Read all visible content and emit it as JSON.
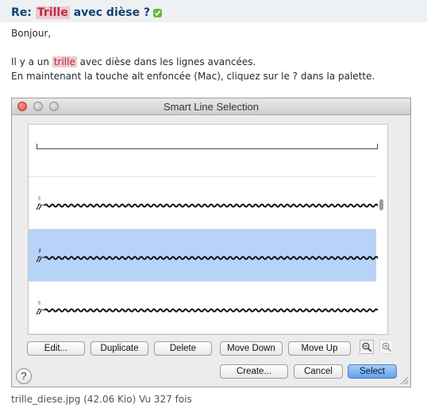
{
  "post": {
    "title_prefix": "Re:",
    "title_highlight": "Trille",
    "title_suffix": "avec dièse ?",
    "greeting": "Bonjour,",
    "line1_before": "Il y a un",
    "line1_highlight": "trille",
    "line1_after": "avec dièse dans les lignes avancées.",
    "line2": "En maintenant la touche alt enfoncée (Mac), cliquez sur le ? dans la palette."
  },
  "dialog": {
    "title": "Smart Line Selection",
    "rows": [
      {
        "kind": "bracket-line",
        "selected": false
      },
      {
        "kind": "trill-natural",
        "selected": false
      },
      {
        "kind": "trill-sharp",
        "selected": true
      },
      {
        "kind": "trill-natural",
        "selected": false
      }
    ],
    "buttons": {
      "edit": "Edit...",
      "duplicate": "Duplicate",
      "delete": "Delete",
      "move_down": "Move Down",
      "move_up": "Move Up",
      "create": "Create...",
      "cancel": "Cancel",
      "select": "Select"
    },
    "help": "?",
    "icons": [
      "zoom-out-icon",
      "zoom-in-icon",
      "help-icon",
      "resize-grip-icon"
    ]
  },
  "caption": "trille_diese.jpg (42.06 Kio) Vu 327 fois",
  "colors": {
    "title": "#16436e",
    "highlight_bg": "#f0c7cf",
    "selected_row": "#b7d3f7",
    "primary_button": "#5fa2ec"
  }
}
